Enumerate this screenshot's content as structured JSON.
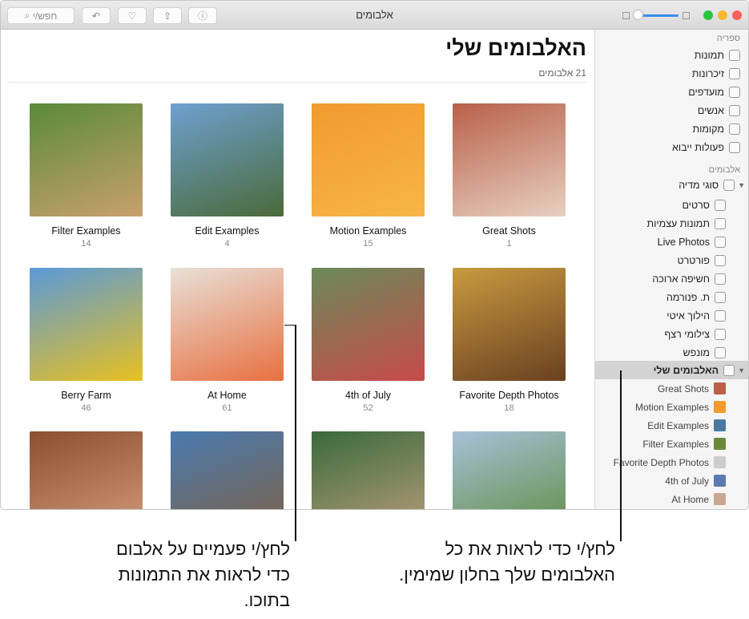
{
  "window": {
    "title": "אלבומים",
    "search_placeholder": "חפש/י"
  },
  "main": {
    "title": "האלבומים שלי",
    "count": "21 אלבומים",
    "albums": [
      {
        "name": "Great Shots",
        "count": "1",
        "colors": [
          "#b8604a",
          "#e8d0c0"
        ]
      },
      {
        "name": "Motion Examples",
        "count": "15",
        "colors": [
          "#f29a2e",
          "#f7b548"
        ]
      },
      {
        "name": "Edit Examples",
        "count": "4",
        "colors": [
          "#6fa0d0",
          "#4a6a3a"
        ]
      },
      {
        "name": "Filter Examples",
        "count": "14",
        "colors": [
          "#5a8a3a",
          "#c8a070"
        ]
      },
      {
        "name": "Favorite Depth Photos",
        "count": "18",
        "colors": [
          "#c89a40",
          "#6a4020"
        ]
      },
      {
        "name": "4th of July",
        "count": "52",
        "colors": [
          "#6a8a5a",
          "#c84a4a"
        ]
      },
      {
        "name": "At Home",
        "count": "61",
        "colors": [
          "#e8e0d8",
          "#e87040"
        ]
      },
      {
        "name": "Berry Farm",
        "count": "46",
        "colors": [
          "#5a9ad8",
          "#e8c020"
        ]
      },
      {
        "name": "",
        "count": "",
        "colors": [
          "#a8c0d8",
          "#5a8a3a"
        ]
      },
      {
        "name": "",
        "count": "",
        "colors": [
          "#3a6a3a",
          "#c0a080"
        ]
      },
      {
        "name": "",
        "count": "",
        "colors": [
          "#4a7ab0",
          "#806040"
        ]
      },
      {
        "name": "",
        "count": "",
        "colors": [
          "#8a5030",
          "#d8a080"
        ]
      }
    ]
  },
  "sidebar": {
    "library_header": "ספריה",
    "library": [
      {
        "label": "תמונות",
        "icon": "photos-icon"
      },
      {
        "label": "זיכרונות",
        "icon": "memories-icon"
      },
      {
        "label": "מועדפים",
        "icon": "heart-icon"
      },
      {
        "label": "אנשים",
        "icon": "person-icon"
      },
      {
        "label": "מקומות",
        "icon": "pin-icon"
      },
      {
        "label": "פעולות ייבוא",
        "icon": "clock-icon"
      }
    ],
    "albums_header": "אלבומים",
    "media_types": {
      "label": "סוגי מדיה",
      "items": [
        {
          "label": "סרטים",
          "icon": "video-icon"
        },
        {
          "label": "תמונות עצמיות",
          "icon": "selfie-icon"
        },
        {
          "label": "Live Photos",
          "icon": "live-photo-icon"
        },
        {
          "label": "פורטרט",
          "icon": "cube-icon"
        },
        {
          "label": "חשיפה ארוכה",
          "icon": "long-exposure-icon"
        },
        {
          "label": "ת. פנורמה",
          "icon": "panorama-icon"
        },
        {
          "label": "הילוך איטי",
          "icon": "slow-mo-icon"
        },
        {
          "label": "צילומי רצף",
          "icon": "burst-icon"
        },
        {
          "label": "מונפש",
          "icon": "animated-icon"
        }
      ]
    },
    "my_albums": {
      "label": "האלבומים שלי",
      "items": [
        {
          "label": "Great Shots",
          "color": "#b8604a"
        },
        {
          "label": "Motion Examples",
          "color": "#f29a2e"
        },
        {
          "label": "Edit Examples",
          "color": "#4a7aa0"
        },
        {
          "label": "Filter Examples",
          "color": "#6a8a3a"
        },
        {
          "label": "Favorite Depth Photos",
          "color": "#cccccc"
        },
        {
          "label": "4th of July",
          "color": "#5a7ab0"
        },
        {
          "label": "At Home",
          "color": "#c8a890"
        }
      ]
    }
  },
  "callouts": {
    "left": "לחץ/י פעמיים על אלבום כדי לראות את התמונות בתוכו.",
    "right": "לחץ/י כדי לראות את כל האלבומים שלך בחלון שמימין."
  }
}
